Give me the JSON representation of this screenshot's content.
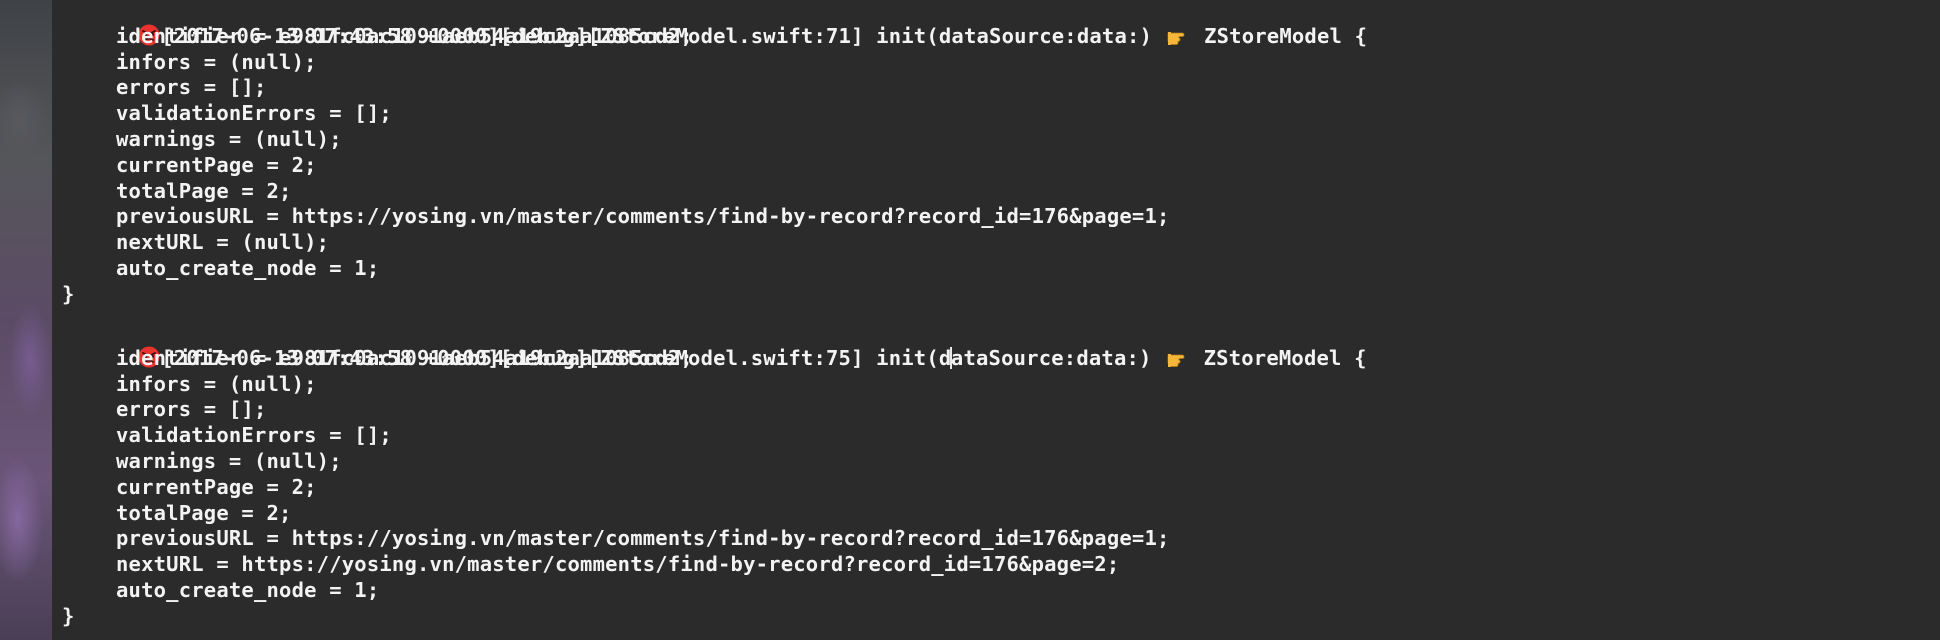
{
  "logs": [
    {
      "header_prefix": "[2017-06-13 07:43:58 +0000][debug][ZStoreModel.swift:71] init(dataSource:data:)",
      "header_suffix": "ZStoreModel {",
      "emoji_left": "angry-face-icon",
      "emoji_right": "pointing-hand-icon",
      "fields": [
        "identifier = e981fc0ac1091aeb54a19c2aa1085cd2;",
        "infors = (null);",
        "errors = [];",
        "validationErrors = [];",
        "warnings = (null);",
        "currentPage = 2;",
        "totalPage = 2;",
        "previousURL = https://yosing.vn/master/comments/find-by-record?record_id=176&page=1;",
        "nextURL = (null);",
        "auto_create_node = 1;"
      ],
      "closing": "}"
    },
    {
      "header_prefix_a": "[2017-06-13 07:43:58 +0000][debug][ZStoreModel.swift:75] init(d",
      "header_prefix_b": "ataSource:data:)",
      "header_suffix": "ZStoreModel {",
      "emoji_left": "angry-face-icon",
      "emoji_right": "pointing-hand-icon",
      "fields": [
        "identifier = e981fc0ac1091aeb54a19c2aa1085cd2;",
        "infors = (null);",
        "errors = [];",
        "validationErrors = [];",
        "warnings = (null);",
        "currentPage = 2;",
        "totalPage = 2;",
        "previousURL = https://yosing.vn/master/comments/find-by-record?record_id=176&page=1;",
        "nextURL = https://yosing.vn/master/comments/find-by-record?record_id=176&page=2;",
        "auto_create_node = 1;"
      ],
      "closing": "}"
    }
  ]
}
